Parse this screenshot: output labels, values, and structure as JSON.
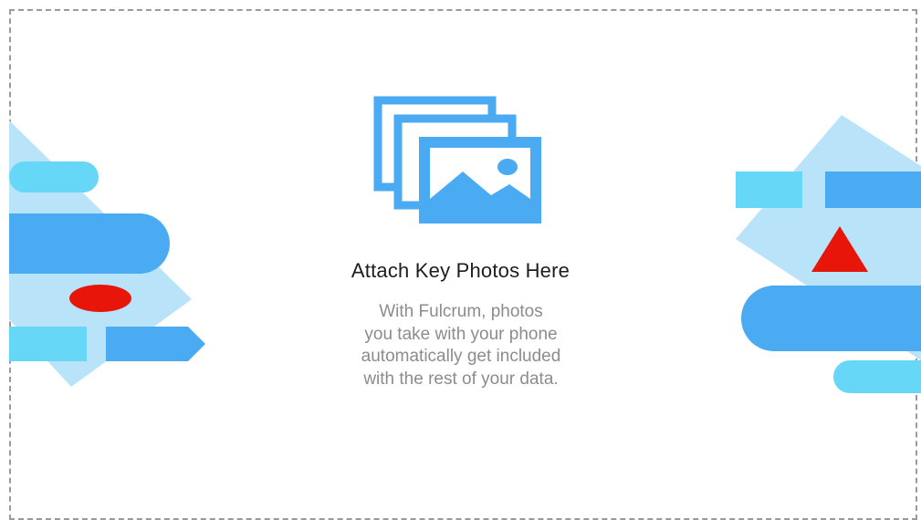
{
  "dropzone": {
    "heading": "Attach Key Photos Here",
    "description_lines": [
      "With Fulcrum, photos",
      "you take with your phone",
      "automatically get included",
      "with the rest of your data."
    ],
    "icon": "photos-stack-icon"
  },
  "colors": {
    "accent_blue": "#4aabf2",
    "light_blue": "#b9e3f9",
    "cyan": "#66d7f6",
    "red": "#e8150a",
    "dash_border": "#9a9a9a",
    "heading_text": "#1d1d1d",
    "body_text": "#8c8c8c"
  }
}
